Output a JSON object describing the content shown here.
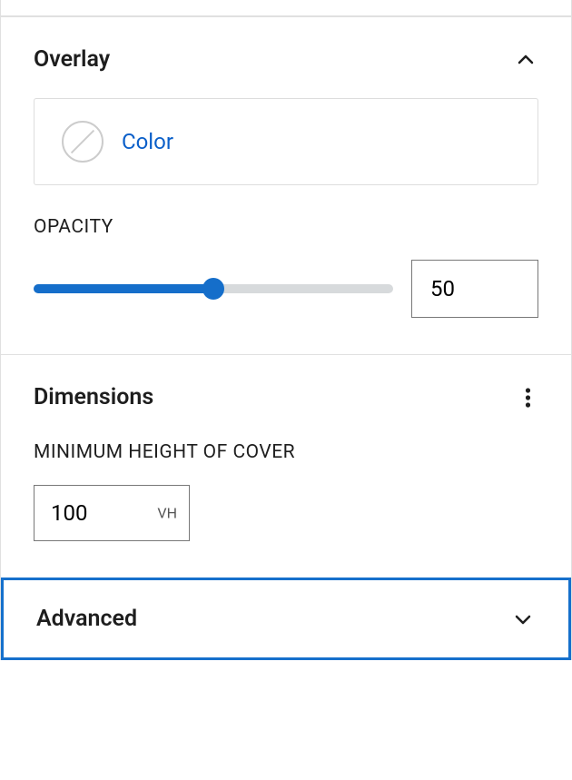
{
  "overlay": {
    "title": "Overlay",
    "color_label": "Color",
    "opacity_label": "OPACITY",
    "opacity_value": "50",
    "opacity_percent": 50
  },
  "dimensions": {
    "title": "Dimensions",
    "min_height_label": "MINIMUM HEIGHT OF COVER",
    "min_height_value": "100",
    "min_height_unit": "VH"
  },
  "advanced": {
    "title": "Advanced"
  }
}
